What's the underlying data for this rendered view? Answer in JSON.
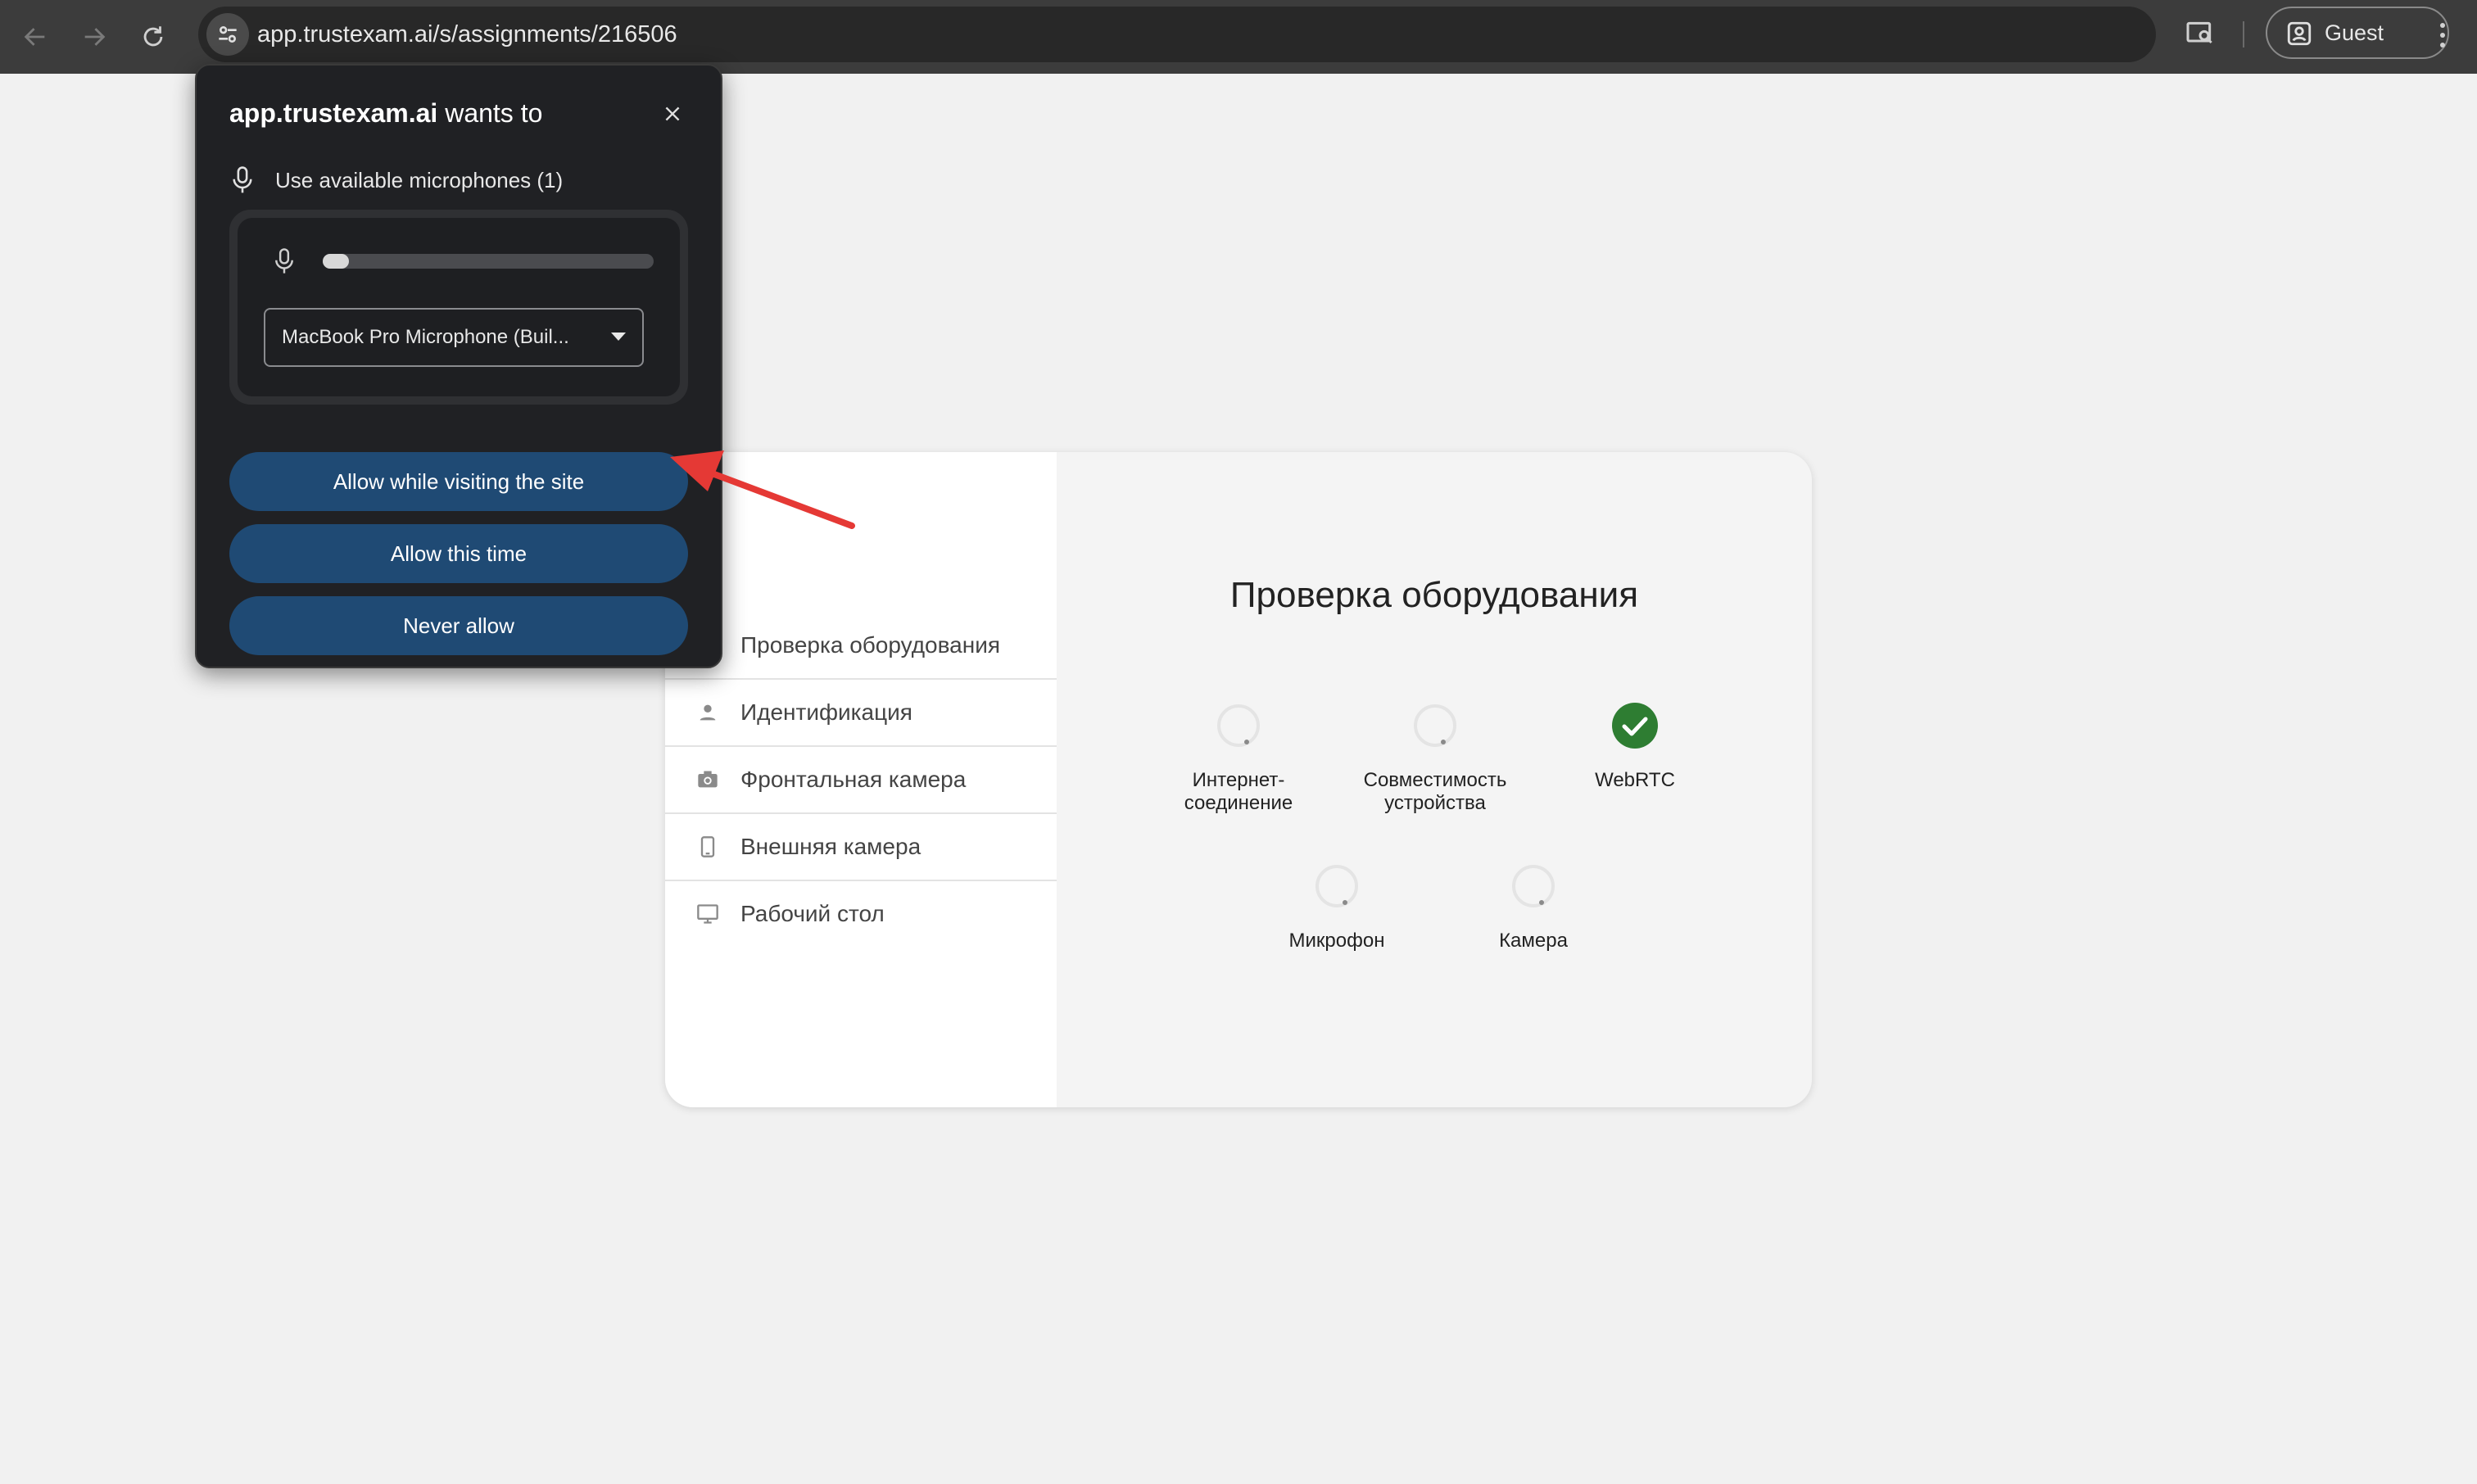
{
  "browser": {
    "url": "app.trustexam.ai/s/assignments/216506",
    "profile_label": "Guest"
  },
  "popup": {
    "site": "app.trustexam.ai",
    "title_suffix": " wants to",
    "permission_text": "Use available microphones (1)",
    "mic_level": 0.08,
    "device_select_value": "MacBook Pro Microphone (Buil...",
    "buttons": {
      "allow_while_visiting": "Allow while visiting the site",
      "allow_this_time": "Allow this time",
      "never_allow": "Never allow"
    }
  },
  "page": {
    "sidebar": [
      {
        "label": "Проверка оборудования",
        "icon": "equipment-check-icon"
      },
      {
        "label": "Идентификация",
        "icon": "person-icon"
      },
      {
        "label": "Фронтальная камера",
        "icon": "camera-icon"
      },
      {
        "label": "Внешняя камера",
        "icon": "phone-icon"
      },
      {
        "label": "Рабочий стол",
        "icon": "monitor-icon"
      }
    ],
    "title": "Проверка оборудования",
    "checks": [
      {
        "label": "Интернет-\nсоединение",
        "status": "loading"
      },
      {
        "label": "Совместимость\nустройства",
        "status": "loading"
      },
      {
        "label": "WebRTC",
        "status": "ok"
      },
      {
        "label": "Микрофон",
        "status": "loading"
      },
      {
        "label": "Камера",
        "status": "loading"
      }
    ]
  },
  "colors": {
    "accent_button": "#1f4a74",
    "success": "#2e7d32",
    "annotation_arrow": "#e53935"
  }
}
